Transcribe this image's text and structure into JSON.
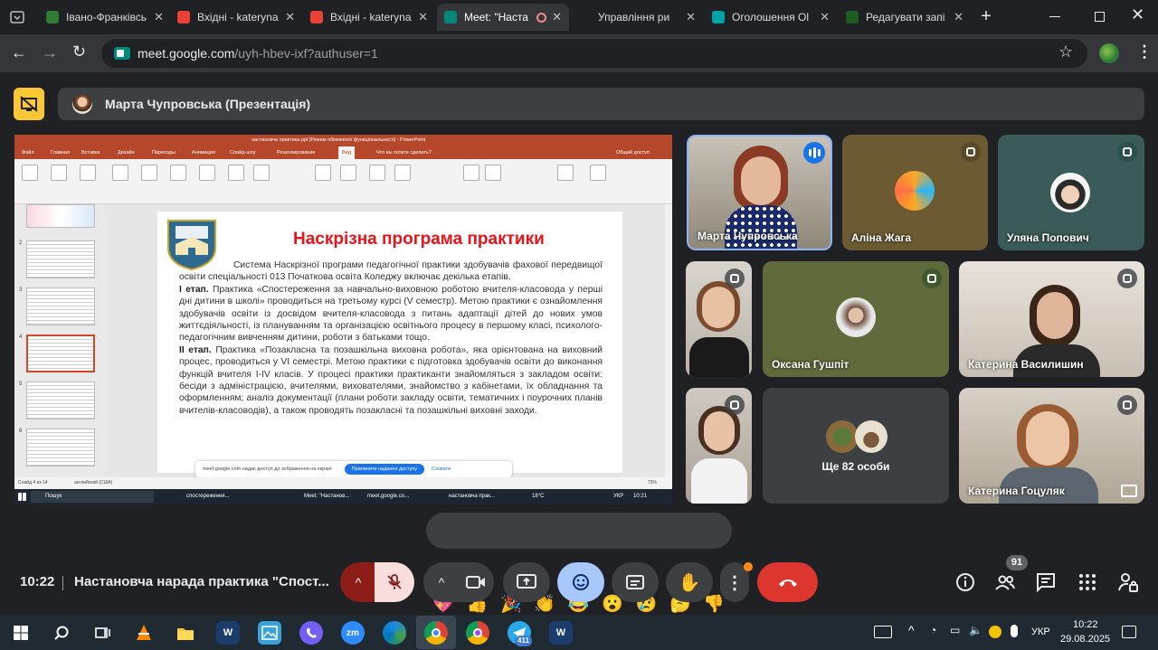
{
  "browser": {
    "tabs": [
      {
        "title": "Івано-Франківсь",
        "fav": "ukraine-flag-icon",
        "color": "#2e7d32"
      },
      {
        "title": "Вхідні - kateryna",
        "fav": "gmail-icon",
        "color": "#ea4335"
      },
      {
        "title": "Вхідні - kateryna",
        "fav": "gmail-icon",
        "color": "#ea4335"
      },
      {
        "title": "Meet: \"Наста",
        "fav": "meet-icon",
        "color": "#00897b",
        "active": true
      },
      {
        "title": "Управління ри",
        "fav": "document-icon",
        "color": "#202124"
      },
      {
        "title": "Оголошення Ol",
        "fav": "olx-icon",
        "color": "#00a3a6"
      },
      {
        "title": "Редагувати запі",
        "fav": "edit-icon",
        "color": "#1b5e20"
      }
    ],
    "new_tab_label": "+",
    "address": {
      "host": "meet.google.com",
      "path": "/uyh-hbev-ixf?authuser=1"
    }
  },
  "meet": {
    "presenter_label": "Марта Чупровська (Презентація)",
    "meeting_time": "10:22",
    "meeting_title": "Настановча нарада практика \"Спост...",
    "participants_count": "91",
    "participants": [
      {
        "name": "Марта Чупровська",
        "speaking": true
      },
      {
        "name": "Аліна Жага"
      },
      {
        "name": "Уляна Попович"
      },
      {
        "name": "Оксана Гушпіт"
      },
      {
        "name": "Катерина Василишин"
      },
      {
        "name": "Катерина Гоцуляк"
      }
    ],
    "others_label": "Ще 82 особи",
    "reactions": [
      "💖",
      "👍",
      "🎉",
      "👏",
      "😂",
      "😮",
      "😢",
      "🤔",
      "👎"
    ]
  },
  "slide": {
    "title": "Наскрізна програма практики",
    "intro": "Система Наскрізної програми педагогічної практики здобувачів фахової передвищої освіти спеціальності 013 Початкова освіта Коледжу включає декілька етапів.",
    "stage1_label": "І етап.",
    "stage1_text": " Практика «Спостереження за навчально-виховною роботою вчителя-класовода у перші дні дитини в школі» проводиться на третьому курсі (V семестр). Метою практики є ознайомлення здобувачів освіти із досвідом вчителя-класовода з питань адаптації дітей до нових умов життєдіяльності, із плануванням та організацією освітнього процесу в першому класі, психолого-педагогічним вивченням дитини, роботи з батьками тощо.",
    "stage2_label": "ІІ етап.",
    "stage2_text": " Практика «Позакласна та позашкільна виховна робота», яка орієнтована на виховний процес, проводиться у VI семестрі. Метою практики є підготовка здобувачів освіти до виконання функцій вчителя І-IV класів. У процесі практики практиканти знайомляться з закладом освіти: бесіди з адміністрацією, вчителями, вихователями, знайомство з кабінетами, їх обладнання та оформленням; аналіз документації (плани роботи закладу освіти, тематичних і поурочних планів вчителів-класоводів), а також проводять позакласні та позашкільні виховні заходи.",
    "share_notice": "meet.google.com надає доступ до зображення на екрані",
    "stop_share": "Припинити надання доступу",
    "hide": "Сховати",
    "status_slide": "Слайд 4 из 14",
    "status_lang": "английский (США)",
    "zoom": "73%",
    "pp_title": "настановча практика.ppt [Режим обмеженої функціональності] - PowerPoint",
    "ribbon_tabs": [
      "Файл",
      "Главная",
      "Вставка",
      "Дизайн",
      "Переходы",
      "Анимация",
      "Слайд-шоу",
      "Рецензирование",
      "Вид",
      "Что вы хотите сделать?",
      "Общий доступ"
    ],
    "thumb_numbers": [
      "2",
      "3",
      "4",
      "5",
      "6"
    ],
    "inner_taskbar": {
      "search": "Пошук",
      "apps": [
        "спостереження...",
        "Meet: \"Настанов...",
        "meet.google.co...",
        "настановча прак..."
      ],
      "weather": "18°C",
      "lang": "УКР",
      "time": "10:21"
    }
  },
  "taskbar": {
    "lang": "УКР",
    "time": "10:22",
    "date": "29.08.2025",
    "telegram_badge": "411"
  },
  "colors": {
    "meet_bg": "#202124",
    "accent_blue": "#a8c7fa",
    "end_call_red": "#dc362e",
    "mic_off_red": "#8c1d18",
    "presenter_yellow": "#fcc934",
    "slide_title_red": "#e8141a"
  }
}
